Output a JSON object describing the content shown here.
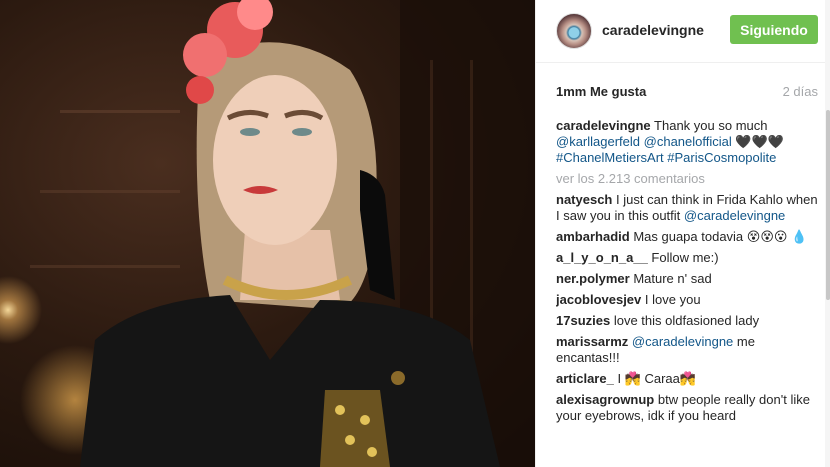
{
  "post": {
    "username": "caradelevingne",
    "follow_button": "Siguiendo",
    "likes": "1mm Me gusta",
    "time": "2 días",
    "colors": {
      "follow_bg": "#70c050",
      "link": "#125688",
      "muted": "#a5a7aa",
      "text": "#262626"
    }
  },
  "caption": {
    "user": "caradelevingne",
    "text": "Thank you so much",
    "mention1": "@karllagerfeld",
    "mention2": "@chanelofficial",
    "hearts": "🖤🖤🖤",
    "tag1": "#ChanelMetiersArt",
    "tag2": "#ParisCosmopolite"
  },
  "view_all": "ver los 2.213 comentarios",
  "comments": [
    {
      "user": "natyesch",
      "text": "I just can think in Frida Kahlo when I saw you in this outfit",
      "mention": "@caradelevingne"
    },
    {
      "user": "ambarhadid",
      "text": "Mas guapa todavia 😵😵😮 💧"
    },
    {
      "user": "a_l_y_o_n_a__",
      "text": "Follow me:)"
    },
    {
      "user": "ner.polymer",
      "text": "Mature n' sad"
    },
    {
      "user": "jacoblovesjev",
      "text": "I love you"
    },
    {
      "user": "17suzies",
      "text": "love this oldfasioned lady"
    },
    {
      "user": "marissarmz",
      "mention": "@caradelevingne",
      "text": "me encantas!!!"
    },
    {
      "user": "articlare_",
      "text": "I 💏 Caraa💏"
    },
    {
      "user": "alexisagrownup",
      "text": "btw people really don't like your eyebrows, idk if you heard"
    }
  ]
}
